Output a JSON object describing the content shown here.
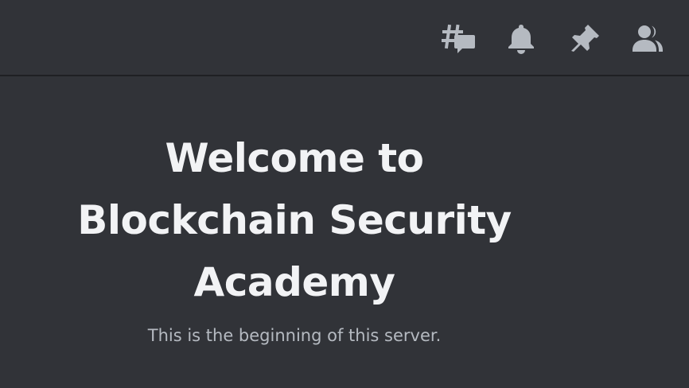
{
  "header": {
    "icons": {
      "threads": "threads-icon",
      "notifications": "notification-bell-icon",
      "pins": "pin-icon",
      "members": "members-icon"
    },
    "icon_color": "#b5bac1",
    "border_color": "#1f2023"
  },
  "welcome": {
    "title": "Welcome to Blockchain Security Academy",
    "subtitle": "This is the beginning of this server."
  },
  "colors": {
    "background": "#313338",
    "title": "#f2f3f5",
    "subtitle": "#b5bac1"
  }
}
